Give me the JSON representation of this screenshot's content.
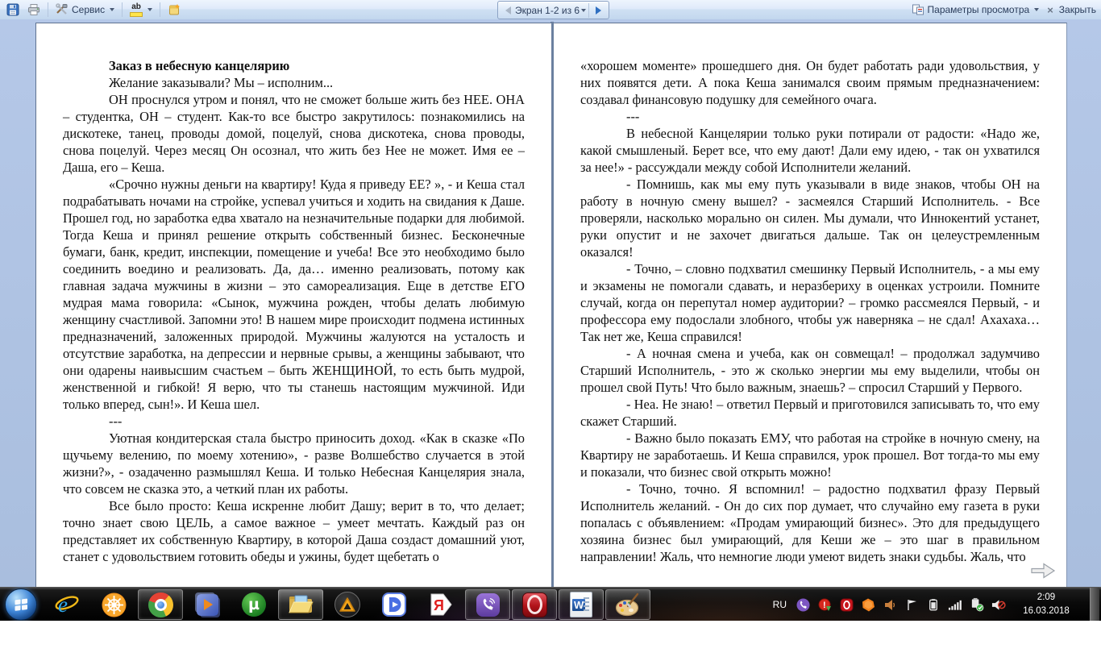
{
  "toolbar": {
    "service_label": "Сервис",
    "screen_nav_label": "Экран 1-2 из 6",
    "view_options_label": "Параметры просмотра",
    "close_label": "Закрыть"
  },
  "document": {
    "left_page": {
      "paragraphs": [
        {
          "cls": "title",
          "text": "Заказ в небесную канцелярию"
        },
        {
          "cls": "",
          "text": "Желание заказывали? Мы – исполним..."
        },
        {
          "cls": "",
          "text": "ОН проснулся утром и понял, что не сможет больше жить без НЕЕ. ОНА – студентка, ОН – студент. Как-то все быстро закрутилось: познакомились на дискотеке, танец, проводы домой, поцелуй, снова дискотека, снова проводы, снова поцелуй. Через месяц Он осознал, что жить без Нее не может. Имя ее – Даша, его – Кеша."
        },
        {
          "cls": "",
          "text": "«Срочно нужны деньги на квартиру! Куда я приведу ЕЕ? », - и Кеша стал подрабатывать ночами на стройке, успевал учиться и ходить на свидания к Даше. Прошел год, но заработка едва хватало на незначительные подарки для любимой. Тогда Кеша и принял решение открыть собственный бизнес. Бесконечные бумаги, банк, кредит, инспекции, помещение и учеба! Все это необходимо было соединить воедино и реализовать. Да, да… именно реализовать, потому как главная задача мужчины в жизни – это самореализация. Еще в детстве ЕГО мудрая мама говорила: «Сынок, мужчина рожден, чтобы делать любимую женщину счастливой. Запомни это! В нашем мире происходит подмена истинных предназначений, заложенных природой. Мужчины жалуются на усталость и отсутствие заработка, на депрессии и нервные срывы, а женщины забывают, что они одарены наивысшим счастьем – быть ЖЕНЩИНОЙ, то есть быть мудрой, женственной и гибкой! Я верю, что ты станешь настоящим мужчиной. Иди только вперед, сын!». И Кеша шел."
        },
        {
          "cls": "",
          "text": "---"
        },
        {
          "cls": "",
          "text": "Уютная кондитерская стала быстро приносить доход. «Как в сказке «По щучьему велению, по моему хотению», - разве Волшебство случается в этой жизни?», - озадаченно размышлял Кеша. И только Небесная Канцелярия знала, что совсем не сказка это, а четкий план их работы."
        },
        {
          "cls": "",
          "text": "Все было просто: Кеша искренне любит Дашу; верит в то, что делает; точно знает свою ЦЕЛЬ, а самое важное – умеет мечтать. Каждый раз он представляет их собственную Квартиру, в которой Даша создаст домашний уют, станет с удовольствием готовить обеды и ужины, будет щебетать о"
        }
      ]
    },
    "right_page": {
      "paragraphs": [
        {
          "cls": "cont",
          "text": "«хорошем моменте» прошедшего дня. Он будет работать ради удовольствия, у них появятся дети. А пока Кеша занимался своим прямым предназначением: создавал финансовую подушку для семейного очага."
        },
        {
          "cls": "",
          "text": "---"
        },
        {
          "cls": "",
          "text": "В небесной Канцелярии только руки потирали от радости: «Надо же, какой смышленый. Берет все, что ему дают! Дали ему идею, - так он ухватился за нее!» - рассуждали между собой Исполнители желаний."
        },
        {
          "cls": "",
          "text": "- Помнишь, как мы ему путь указывали в виде знаков, чтобы ОН на работу в ночную смену вышел? - засмеялся Старший Исполнитель. - Все проверяли, насколько морально он силен. Мы думали, что Иннокентий устанет, руки опустит и не захочет двигаться дальше. Так он целеустремленным оказался!"
        },
        {
          "cls": "",
          "text": "- Точно, – словно подхватил смешинку Первый Исполнитель, - а мы ему и экзамены не помогали сдавать, и неразбериху в оценках устроили. Помните случай, когда он перепутал номер аудитории? – громко рассмеялся Первый, - и профессора ему подослали злобного, чтобы уж наверняка – не сдал! Ахахаха…Так нет же, Кеша справился!"
        },
        {
          "cls": "",
          "text": "- А ночная смена и учеба, как он совмещал! – продолжал задумчиво Старший Исполнитель, - это ж сколько энергии мы ему выделили, чтобы он прошел свой Путь! Что было важным, знаешь? – спросил Старший у Первого."
        },
        {
          "cls": "",
          "text": "- Неа. Не знаю! – ответил Первый и приготовился записывать то, что ему скажет Старший."
        },
        {
          "cls": "",
          "text": "- Важно было показать ЕМУ, что работая на стройке в ночную смену, на Квартиру не заработаешь. И Кеша справился, урок прошел. Вот тогда-то мы ему и показали, что бизнес свой открыть можно!"
        },
        {
          "cls": "",
          "text": "- Точно, точно. Я вспомнил! – радостно подхватил фразу Первый Исполнитель желаний. - Он до сих пор думает, что случайно ему газета в руки попалась с объявлением: «Продам умирающий бизнес». Это для предыдущего хозяина бизнес был умирающий, для Кеши же – это шаг в правильном направлении! Жаль, что немногие люди умеют видеть знаки судьбы. Жаль, что"
        }
      ]
    }
  },
  "taskbar": {
    "language": "RU",
    "time": "2:09",
    "date": "16.03.2018",
    "utorrent_glyph": "µ",
    "yandex_glyph": "Я",
    "word_glyph": "W"
  },
  "icons": {
    "toolbar": [
      "save-icon",
      "print-icon",
      "tools-icon",
      "highlighter-icon",
      "new-comment-icon",
      "prev-screen-icon",
      "next-screen-icon",
      "view-options-icon",
      "close-icon"
    ],
    "taskbar_buttons": [
      "start",
      "internet-explorer",
      "ship-wheel-browser",
      "chrome",
      "media-player",
      "utorrent",
      "explorer-folder",
      "aimp",
      "d-player",
      "yandex-browser",
      "viber",
      "opera",
      "word",
      "paint"
    ],
    "tray": [
      "viber",
      "alert-updater",
      "opera",
      "avast",
      "volume",
      "action-center-flag",
      "battery",
      "network-signal",
      "usb-safely-remove",
      "volume-muted"
    ],
    "page_nav": [
      "next-page-arrow"
    ]
  },
  "colors": {
    "reading_background": "#aec3e3",
    "toolbar_blue": "#d5e4f6",
    "taskbar_black": "#0a0a0a",
    "accent_word_blue": "#2b5797"
  }
}
